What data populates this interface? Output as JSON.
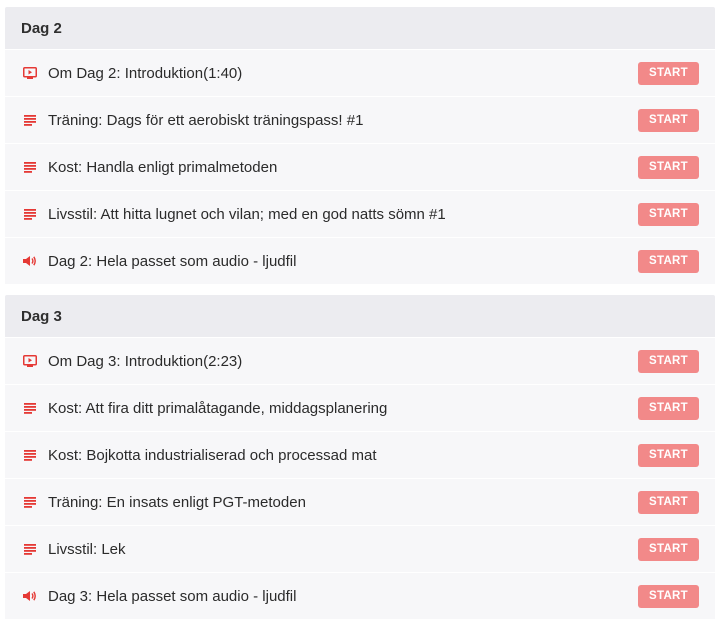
{
  "colors": {
    "accent": "#e53935",
    "button": "#f28989",
    "header_bg": "#ececf0",
    "row_bg": "#f7f7f9"
  },
  "sections": [
    {
      "title": "Dag 2",
      "lessons": [
        {
          "icon": "video-icon",
          "title": "Om Dag 2: Introduktion(1:40)",
          "button": "START"
        },
        {
          "icon": "text-lines-icon",
          "title": "Träning: Dags för ett aerobiskt träningspass! #1",
          "button": "START"
        },
        {
          "icon": "text-lines-icon",
          "title": "Kost: Handla enligt primalmetoden",
          "button": "START"
        },
        {
          "icon": "text-lines-icon",
          "title": "Livsstil: Att hitta lugnet och vilan; med en god natts sömn #1",
          "button": "START"
        },
        {
          "icon": "audio-icon",
          "title": "Dag 2: Hela passet som audio - ljudfil",
          "button": "START"
        }
      ]
    },
    {
      "title": "Dag 3",
      "lessons": [
        {
          "icon": "video-icon",
          "title": "Om Dag 3: Introduktion(2:23)",
          "button": "START"
        },
        {
          "icon": "text-lines-icon",
          "title": "Kost: Att fira ditt primalåtagande, middagsplanering",
          "button": "START"
        },
        {
          "icon": "text-lines-icon",
          "title": "Kost: Bojkotta industrialiserad och processad mat",
          "button": "START"
        },
        {
          "icon": "text-lines-icon",
          "title": "Träning: En insats enligt PGT-metoden",
          "button": "START"
        },
        {
          "icon": "text-lines-icon",
          "title": "Livsstil: Lek",
          "button": "START"
        },
        {
          "icon": "audio-icon",
          "title": "Dag 3: Hela passet som audio - ljudfil",
          "button": "START"
        }
      ]
    }
  ]
}
